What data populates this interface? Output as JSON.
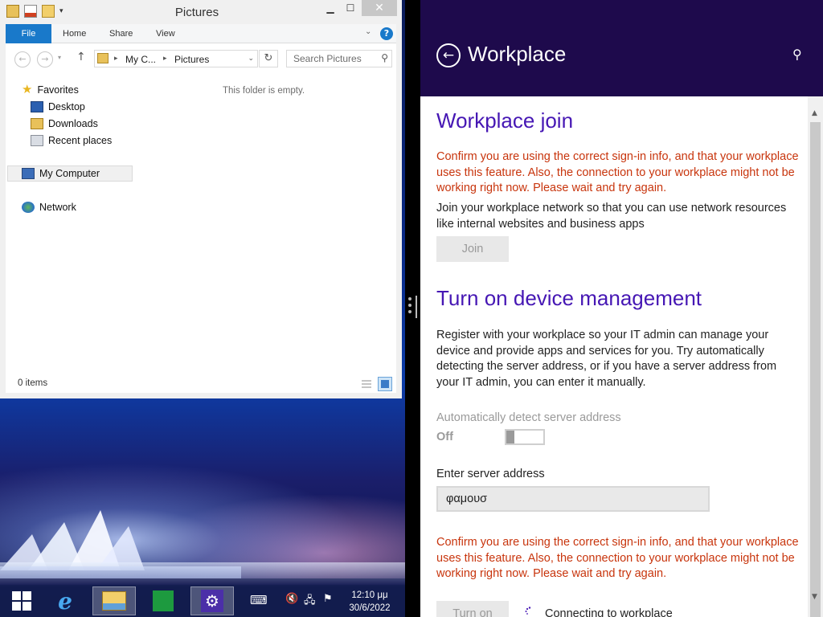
{
  "explorer": {
    "title": "Pictures",
    "tabs": {
      "file": "File",
      "home": "Home",
      "share": "Share",
      "view": "View"
    },
    "address": {
      "crumb1": "My C...",
      "crumb2": "Pictures"
    },
    "search_placeholder": "Search Pictures",
    "nav": {
      "favorites": "Favorites",
      "desktop": "Desktop",
      "downloads": "Downloads",
      "recent": "Recent places",
      "computer": "My Computer",
      "network": "Network"
    },
    "empty_message": "This folder is empty.",
    "status": "0 items"
  },
  "taskbar": {
    "time": "12:10 μμ",
    "date": "30/6/2022"
  },
  "settings": {
    "title": "Workplace",
    "join_heading": "Workplace join",
    "error_text": "Confirm you are using the correct sign-in info, and that your workplace uses this feature. Also, the connection to your workplace might not be working right now. Please wait and try again.",
    "join_description": "Join your workplace network so that you can use network resources like internal websites and business apps",
    "join_button": "Join",
    "device_heading": "Turn on device management",
    "device_description": "Register with your workplace so your IT admin can manage your device and provide apps and services for you. Try automatically detecting the server address, or if you have a server address from your IT admin, you can enter it manually.",
    "auto_detect_label": "Automatically detect server address",
    "auto_detect_state": "Off",
    "server_label": "Enter server address",
    "server_value": "φαμουσ",
    "error_text_2": "Confirm you are using the correct sign-in info, and that your workplace uses this feature. Also, the connection to your workplace might not be working right now. Please wait and try again.",
    "turn_on_button": "Turn on",
    "connecting_text": "Connecting to workplace"
  }
}
